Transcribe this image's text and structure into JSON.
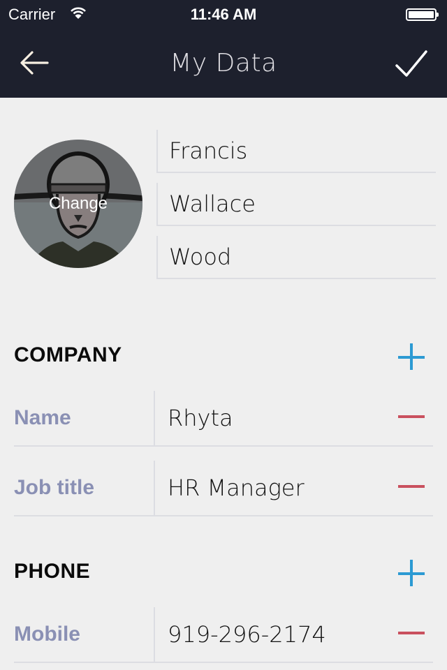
{
  "status_bar": {
    "carrier": "Carrier",
    "time": "11:46 AM",
    "icons": [
      "wifi-icon",
      "battery-icon"
    ]
  },
  "nav": {
    "title": "My Data",
    "back_icon": "arrow-left-icon",
    "done_icon": "checkmark-icon"
  },
  "profile": {
    "avatar_action": "Change",
    "first_name": "Francis",
    "middle_name": "Wallace",
    "last_name": "Wood"
  },
  "company": {
    "title": "COMPANY",
    "add_icon": "plus-icon",
    "rows": [
      {
        "label": "Name",
        "value": "Rhyta"
      },
      {
        "label": "Job title",
        "value": "HR Manager"
      }
    ]
  },
  "phone": {
    "title": "PHONE",
    "add_icon": "plus-icon",
    "rows": [
      {
        "label": "Mobile",
        "value": "919-296-2174"
      }
    ]
  },
  "colors": {
    "header_bg": "#1d202d",
    "accent_add": "#2c9ad3",
    "accent_remove": "#c9505e",
    "label": "#8a90b4"
  }
}
